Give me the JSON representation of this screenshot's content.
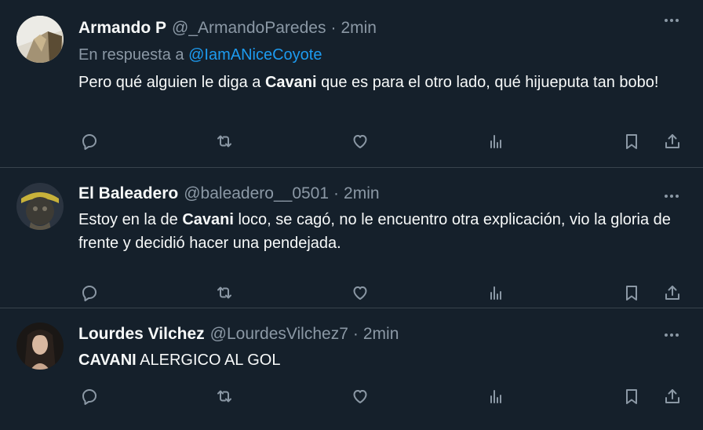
{
  "colors": {
    "background": "#15202b",
    "divider": "#38444d",
    "primary_text": "#f7f9f9",
    "secondary_text": "#8b98a5",
    "link": "#1d9bf0"
  },
  "tweets": [
    {
      "author": "Armando P",
      "handle": "@_ArmandoParedes",
      "separator": "·",
      "time": "2min",
      "reply_prefix": "En respuesta a",
      "reply_to": "@IamANiceCoyote",
      "text_before": "Pero qué alguien le diga a ",
      "text_bold": "Cavani",
      "text_after": " que es para el otro lado, qué hijueputa tan bobo!",
      "icons": [
        "more-icon",
        "reply-icon",
        "retweet-icon",
        "like-icon",
        "views-icon",
        "bookmark-icon",
        "share-icon"
      ]
    },
    {
      "author": "El Baleadero",
      "handle": "@baleadero__0501",
      "separator": "·",
      "time": "2min",
      "text_before": "Estoy en la de ",
      "text_bold": "Cavani",
      "text_after": " loco, se cagó, no le encuentro otra explicación, vio la gloria de frente y decidió hacer una pendejada.",
      "icons": [
        "more-icon",
        "reply-icon",
        "retweet-icon",
        "like-icon",
        "views-icon",
        "bookmark-icon",
        "share-icon"
      ]
    },
    {
      "author": "Lourdes Vilchez",
      "handle": "@LourdesVilchez7",
      "separator": "·",
      "time": "2min",
      "text_before": "",
      "text_bold": "CAVANI",
      "text_after": " ALERGICO AL GOL",
      "icons": [
        "more-icon",
        "reply-icon",
        "retweet-icon",
        "like-icon",
        "views-icon",
        "bookmark-icon",
        "share-icon"
      ]
    }
  ]
}
